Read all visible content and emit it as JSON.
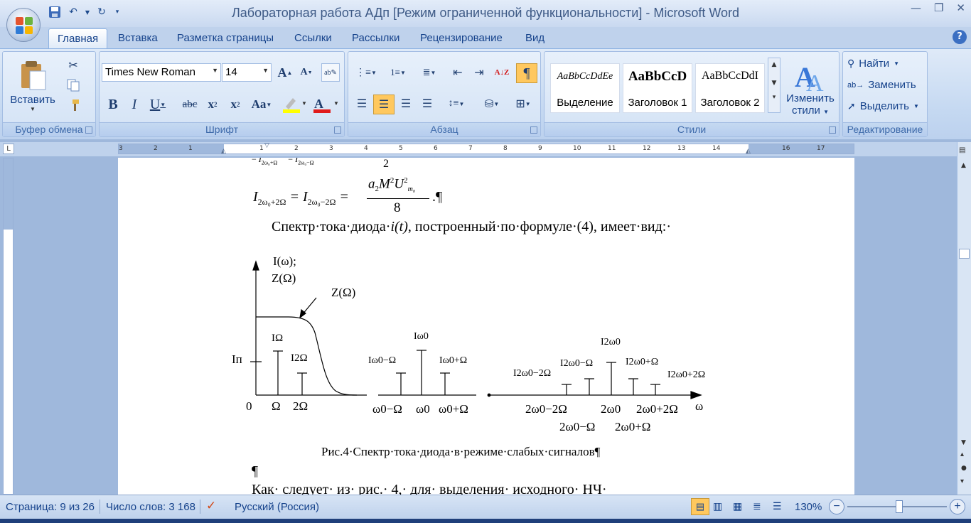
{
  "window": {
    "title": "Лабораторная работа АДп [Режим ограниченной функциональности]  -  Microsoft Word"
  },
  "tabs": [
    "Главная",
    "Вставка",
    "Разметка страницы",
    "Ссылки",
    "Рассылки",
    "Рецензирование",
    "Вид"
  ],
  "active_tab": "Главная",
  "ribbon": {
    "clipboard": {
      "label": "Буфер обмена",
      "paste": "Вставить"
    },
    "font": {
      "label": "Шрифт",
      "font_name": "Times New Roman",
      "font_size": "14"
    },
    "paragraph": {
      "label": "Абзац"
    },
    "styles": {
      "label": "Стили",
      "items": [
        {
          "sample": "AaBbCcDdEe",
          "name": "Выделение"
        },
        {
          "sample": "AaBbCcD",
          "name": "Заголовок 1"
        },
        {
          "sample": "AaBbCcDdI",
          "name": "Заголовок 2"
        }
      ],
      "change_line1": "Изменить",
      "change_line2": "стили"
    },
    "editing": {
      "label": "Редактирование",
      "find": "Найти",
      "replace": "Заменить",
      "select": "Выделить"
    }
  },
  "ruler_numbers": [
    "3",
    "2",
    "1",
    "1",
    "2",
    "3",
    "4",
    "5",
    "6",
    "7",
    "8",
    "9",
    "10",
    "11",
    "12",
    "13",
    "14",
    "16",
    "17"
  ],
  "document": {
    "top_fraction_denominator": "2",
    "formula_fraction_denominator": "8",
    "paragraph_mark": "¶",
    "spectrum_text": "Спектр·тока·диода·",
    "spectrum_var": "i(t)",
    "spectrum_tail": ", построенный·по·формуле·(4), имеет·вид:·",
    "figure": {
      "y_axis_label_1": "I(ω);",
      "y_axis_label_2": "Z(Ω)",
      "curve_label": "Z(Ω)",
      "zero_label": "0",
      "x_axis_label": "ω",
      "pedestal_label": "Iп",
      "line_labels": [
        "IΩ",
        "I2Ω",
        "Iω0−Ω",
        "Iω0",
        "Iω0+Ω",
        "I2ω0−2Ω",
        "I2ω0−Ω",
        "I2ω0",
        "I2ω0+Ω",
        "I2ω0+2Ω"
      ],
      "x_tick_labels_row1": [
        "Ω",
        "2Ω",
        "ω0−Ω",
        "ω0",
        "ω0+Ω",
        "2ω0−2Ω",
        "2ω0",
        "2ω0+2Ω"
      ],
      "x_tick_labels_row2": [
        "2ω0−Ω",
        "2ω0+Ω"
      ]
    },
    "caption": "Рис.4·Спектр·тока·диода·в·режиме·слабых·сигналов¶",
    "empty_paragraph": "¶",
    "bottom_text": "Как·  следует·  из·  рис.·  4,·  для·  выделения·  исходного·  НЧ·"
  },
  "statusbar": {
    "page": "Страница: 9 из 26",
    "words": "Число слов: 3 168",
    "language": "Русский (Россия)",
    "zoom": "130%"
  }
}
